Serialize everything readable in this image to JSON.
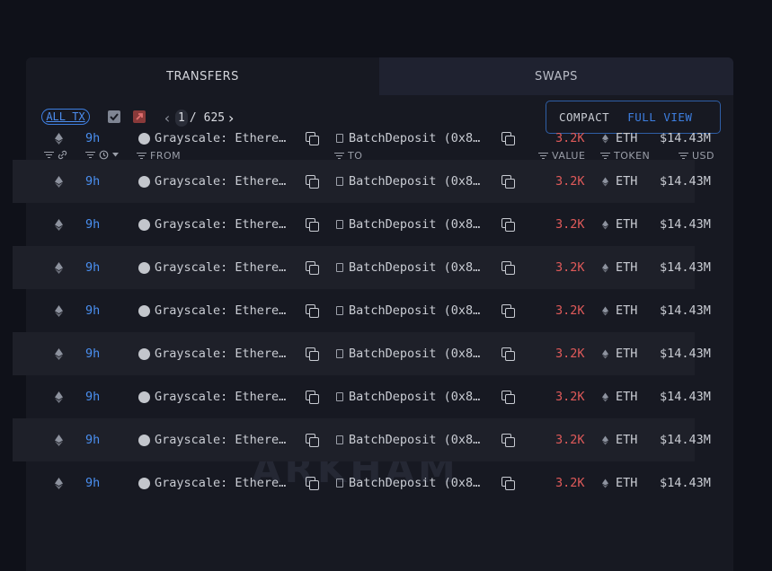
{
  "tabs": [
    {
      "label": "TRANSFERS",
      "active": true
    },
    {
      "label": "SWAPS",
      "active": false
    }
  ],
  "toolbar": {
    "filter_label": "ALL TX",
    "pagination": {
      "current": "1",
      "separator": "/",
      "total": "625"
    },
    "view_toggle": {
      "compact": "COMPACT",
      "full": "FULL VIEW",
      "selected": "FULL VIEW"
    }
  },
  "columns": {
    "from": "FROM",
    "to": "TO",
    "value": "VALUE",
    "token": "TOKEN",
    "usd": "USD"
  },
  "rows": [
    {
      "chain_icon": "ethereum-icon",
      "time": "9h",
      "from": "Grayscale: Ethere…",
      "to": "BatchDeposit (0x8…",
      "value": "3.2K",
      "token": "ETH",
      "usd": "$14.43M"
    },
    {
      "chain_icon": "ethereum-icon",
      "time": "9h",
      "from": "Grayscale: Ethere…",
      "to": "BatchDeposit (0x8…",
      "value": "3.2K",
      "token": "ETH",
      "usd": "$14.43M"
    },
    {
      "chain_icon": "ethereum-icon",
      "time": "9h",
      "from": "Grayscale: Ethere…",
      "to": "BatchDeposit (0x8…",
      "value": "3.2K",
      "token": "ETH",
      "usd": "$14.43M"
    },
    {
      "chain_icon": "ethereum-icon",
      "time": "9h",
      "from": "Grayscale: Ethere…",
      "to": "BatchDeposit (0x8…",
      "value": "3.2K",
      "token": "ETH",
      "usd": "$14.43M"
    },
    {
      "chain_icon": "ethereum-icon",
      "time": "9h",
      "from": "Grayscale: Ethere…",
      "to": "BatchDeposit (0x8…",
      "value": "3.2K",
      "token": "ETH",
      "usd": "$14.43M"
    },
    {
      "chain_icon": "ethereum-icon",
      "time": "9h",
      "from": "Grayscale: Ethere…",
      "to": "BatchDeposit (0x8…",
      "value": "3.2K",
      "token": "ETH",
      "usd": "$14.43M"
    },
    {
      "chain_icon": "ethereum-icon",
      "time": "9h",
      "from": "Grayscale: Ethere…",
      "to": "BatchDeposit (0x8…",
      "value": "3.2K",
      "token": "ETH",
      "usd": "$14.43M"
    },
    {
      "chain_icon": "ethereum-icon",
      "time": "9h",
      "from": "Grayscale: Ethere…",
      "to": "BatchDeposit (0x8…",
      "value": "3.2K",
      "token": "ETH",
      "usd": "$14.43M"
    },
    {
      "chain_icon": "ethereum-icon",
      "time": "9h",
      "from": "Grayscale: Ethere…",
      "to": "BatchDeposit (0x8…",
      "value": "3.2K",
      "token": "ETH",
      "usd": "$14.43M"
    }
  ],
  "watermark": "ARKHAM",
  "colors": {
    "accent": "#3d7ee0",
    "value_negative": "#e05a5a",
    "time": "#4a8ff0",
    "background": "#0f1119",
    "panel": "#171922"
  }
}
